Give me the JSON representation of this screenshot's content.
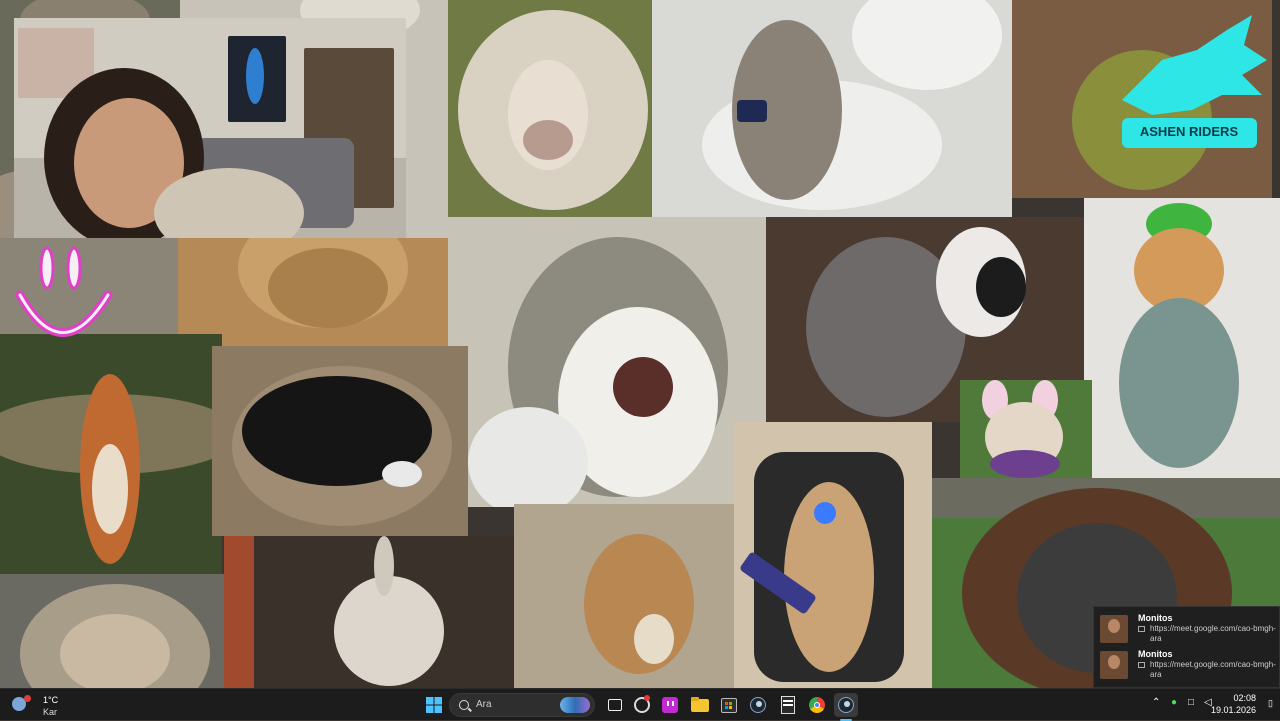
{
  "wallpaper": {
    "tiles": [
      "webcam-streamer",
      "sheep-with-hair",
      "cat-on-toilet-with-phone",
      "ashen-riders-logo",
      "orange-cat-blurry",
      "surprised-cat",
      "dog-and-cat-fighting",
      "cat-in-green-hat",
      "squirrel-arms-up",
      "black-dog-with-controller",
      "bulldog-bunny-ears",
      "monkey-sleeping",
      "donkey",
      "dog-with-bread",
      "cat-gaming-chair",
      "orangutan"
    ],
    "ashen_riders_text": "ASHEN RIDERS"
  },
  "notifications": [
    {
      "title": "Monitos",
      "body": "https://meet.google.com/cao-bmgh-ara"
    },
    {
      "title": "Monitos",
      "body": "https://meet.google.com/cao-bmgh-ara"
    }
  ],
  "taskbar": {
    "weather": {
      "temp": "1°C",
      "condition": "Kar"
    },
    "search_placeholder": "Ara",
    "apps": [
      "windows-start-icon",
      "file-view-icon",
      "copilot-icon",
      "twitch-icon",
      "file-explorer-icon",
      "microsoft-store-icon",
      "steam-icon",
      "epic-games-icon",
      "chrome-icon",
      "steam-active-icon"
    ],
    "clock": {
      "time": "02:08",
      "date": "19.01.2026"
    }
  },
  "colors": {
    "taskbar_bg": "#1c1c1c",
    "accent_magenta": "#e040c8",
    "ashen_cyan": "#2ee6e6"
  }
}
